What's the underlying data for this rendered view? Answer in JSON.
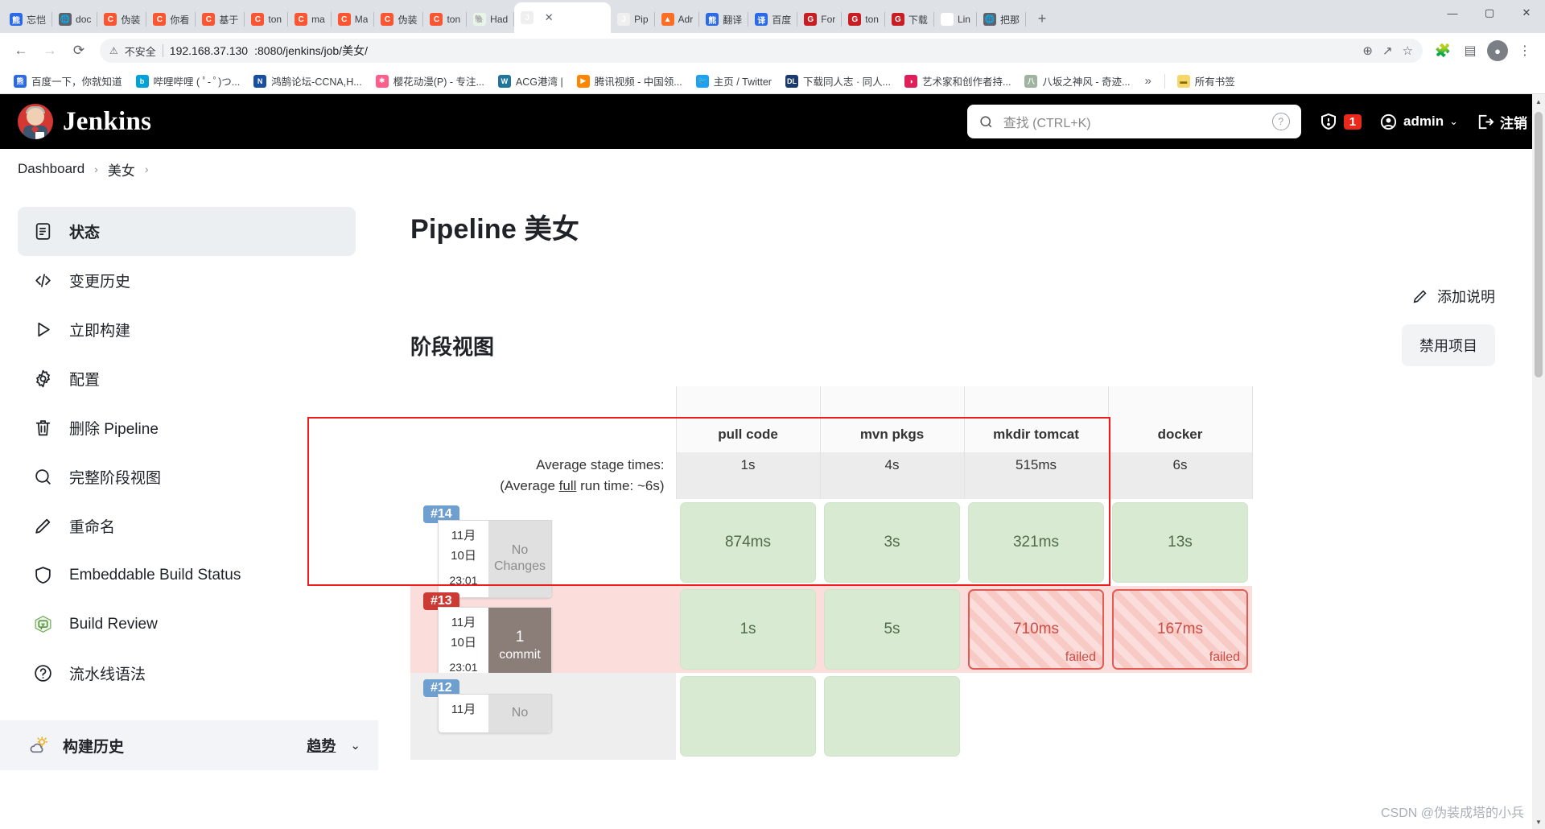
{
  "browser": {
    "tabs": [
      {
        "label": "忘恺",
        "icon": "baidu-favicon",
        "glyph": "熊",
        "cls": "fav-baidu",
        "active": false
      },
      {
        "label": "doc",
        "icon": "globe-favicon",
        "glyph": "🌐",
        "cls": "fav-globe",
        "active": false
      },
      {
        "label": "伪装",
        "icon": "csdn-favicon",
        "glyph": "C",
        "cls": "fav-csdn",
        "active": false
      },
      {
        "label": "你看",
        "icon": "csdn-favicon",
        "glyph": "C",
        "cls": "fav-csdn",
        "active": false
      },
      {
        "label": "基于",
        "icon": "csdn-favicon",
        "glyph": "C",
        "cls": "fav-csdn",
        "active": false
      },
      {
        "label": "ton",
        "icon": "csdn-favicon",
        "glyph": "C",
        "cls": "fav-csdn",
        "active": false
      },
      {
        "label": "ma",
        "icon": "csdn-favicon",
        "glyph": "C",
        "cls": "fav-csdn",
        "active": false
      },
      {
        "label": "Ma",
        "icon": "csdn-favicon",
        "glyph": "C",
        "cls": "fav-csdn",
        "active": false
      },
      {
        "label": "伪装",
        "icon": "csdn-favicon",
        "glyph": "C",
        "cls": "fav-csdn",
        "active": false
      },
      {
        "label": "ton",
        "icon": "csdn-favicon",
        "glyph": "C",
        "cls": "fav-csdn",
        "active": false
      },
      {
        "label": "Had",
        "icon": "hadoop-favicon",
        "glyph": "🐘",
        "cls": "fav-hadoop",
        "active": false
      },
      {
        "label": "",
        "icon": "jenkins-favicon",
        "glyph": "J",
        "cls": "fav-jenkins",
        "active": true
      },
      {
        "label": "Pip",
        "icon": "jenkins-favicon",
        "glyph": "J",
        "cls": "fav-jenkins",
        "active": false
      },
      {
        "label": "Adr",
        "icon": "gitlab-favicon",
        "glyph": "▲",
        "cls": "fav-gitlab",
        "active": false
      },
      {
        "label": "翻译",
        "icon": "baidu-favicon",
        "glyph": "熊",
        "cls": "fav-baidu",
        "active": false
      },
      {
        "label": "百度",
        "icon": "translate-favicon",
        "glyph": "译",
        "cls": "fav-trans",
        "active": false
      },
      {
        "label": "For",
        "icon": "gitee-favicon",
        "glyph": "G",
        "cls": "fav-gitee",
        "active": false
      },
      {
        "label": "ton",
        "icon": "gitee-favicon",
        "glyph": "G",
        "cls": "fav-gitee",
        "active": false
      },
      {
        "label": "下载",
        "icon": "gitee-favicon",
        "glyph": "G",
        "cls": "fav-gitee",
        "active": false
      },
      {
        "label": "Lin",
        "icon": "linux-favicon",
        "glyph": "∞",
        "cls": "fav-linux",
        "active": false
      },
      {
        "label": "把那",
        "icon": "globe-favicon",
        "glyph": "🌐",
        "cls": "fav-globe",
        "active": false
      }
    ],
    "new_tab_label": "+",
    "window_controls": {
      "minimize": "—",
      "maximize": "▢",
      "close": "✕"
    },
    "omnibox": {
      "security_label": "不安全",
      "url_host": "192.168.37.130",
      "url_rest": ":8080/jenkins/job/美女/"
    },
    "bookmarks": [
      {
        "label": "百度一下，你就知道",
        "glyph": "熊",
        "cls": "fav-baidu"
      },
      {
        "label": "哔哩哔哩 ( ﾟ- ﾟ)つ...",
        "glyph": "b",
        "cls": "bm-bili"
      },
      {
        "label": "鸿鹄论坛-CCNA,H...",
        "glyph": "N",
        "cls": "bm-hh"
      },
      {
        "label": "樱花动漫(P) - 专注...",
        "glyph": "✱",
        "cls": "bm-sakura"
      },
      {
        "label": "ACG港湾 |",
        "glyph": "W",
        "cls": "bm-acg"
      },
      {
        "label": "腾讯视频 - 中国领...",
        "glyph": "▶",
        "cls": "bm-tx"
      },
      {
        "label": "主页 / Twitter",
        "glyph": "🐦",
        "cls": "bm-tw"
      },
      {
        "label": "下载同人志 · 同人...",
        "glyph": "DL",
        "cls": "bm-dl"
      },
      {
        "label": "艺术家和创作者持...",
        "glyph": "◑",
        "cls": "bm-pixiv"
      },
      {
        "label": "八坂之神风 - 奇迹...",
        "glyph": "八",
        "cls": "bm-yasaka"
      }
    ],
    "bookmarks_overflow": "»",
    "all_bookmarks_label": "所有书签"
  },
  "jenkins": {
    "brand": "Jenkins",
    "search_placeholder": "查找 (CTRL+K)",
    "help_icon": "question-mark-icon",
    "notifications_count": "1",
    "user_name": "admin",
    "logout_label": "注销",
    "breadcrumbs": [
      "Dashboard",
      "美女"
    ],
    "breadcrumb_sep": "›"
  },
  "sidebar": {
    "items": [
      {
        "label": "状态",
        "icon": "status-icon",
        "active": true
      },
      {
        "label": "变更历史",
        "icon": "code-icon",
        "active": false
      },
      {
        "label": "立即构建",
        "icon": "play-icon",
        "active": false
      },
      {
        "label": "配置",
        "icon": "gear-icon",
        "active": false
      },
      {
        "label": "删除 Pipeline",
        "icon": "trash-icon",
        "active": false
      },
      {
        "label": "完整阶段视图",
        "icon": "search-icon",
        "active": false
      },
      {
        "label": "重命名",
        "icon": "pencil-icon",
        "active": false
      },
      {
        "label": "Embeddable Build Status",
        "icon": "shield-icon",
        "active": false
      },
      {
        "label": "Build Review",
        "icon": "review-icon",
        "active": false
      },
      {
        "label": "流水线语法",
        "icon": "help-icon",
        "active": false
      }
    ],
    "build_history": {
      "title": "构建历史",
      "icon": "weather-icon",
      "trend_label": "趋势",
      "caret": "⌄"
    }
  },
  "main": {
    "page_title": "Pipeline 美女",
    "add_description_label": "添加说明",
    "disable_project_label": "禁用项目",
    "stage_view_title": "阶段视图",
    "average_label_line1": "Average stage times:",
    "average_label_line2_pre": "(Average ",
    "average_label_line2_u": "full",
    "average_label_line2_post": " run time: ~6s)"
  },
  "chart_data": {
    "type": "table",
    "title": "阶段视图",
    "stages": [
      "pull code",
      "mvn pkgs",
      "mkdir tomcat",
      "docker"
    ],
    "average_stage_times": [
      "1s",
      "4s",
      "515ms",
      "6s"
    ],
    "average_full_run_time": "~6s",
    "meter_percents": [
      {
        "offset": 4,
        "width": 14
      },
      {
        "offset": 2,
        "width": 38
      },
      {
        "offset": 56,
        "width": 6
      },
      {
        "offset": 40,
        "width": 60
      }
    ],
    "rows": [
      {
        "build": "#14",
        "status": "ok",
        "month": "11月",
        "day": "10日",
        "time": "23:01",
        "changes_big": "No",
        "changes_small": "Changes",
        "changes_type": "nochg",
        "cells": [
          {
            "value": "874ms",
            "state": "success"
          },
          {
            "value": "3s",
            "state": "success"
          },
          {
            "value": "321ms",
            "state": "success"
          },
          {
            "value": "13s",
            "state": "success"
          }
        ]
      },
      {
        "build": "#13",
        "status": "fail",
        "month": "11月",
        "day": "10日",
        "time": "23:01",
        "changes_big": "1",
        "changes_small": "commit",
        "changes_type": "commit",
        "cells": [
          {
            "value": "1s",
            "state": "success"
          },
          {
            "value": "5s",
            "state": "success"
          },
          {
            "value": "710ms",
            "state": "failed",
            "fail_label": "failed"
          },
          {
            "value": "167ms",
            "state": "failed",
            "fail_label": "failed"
          }
        ]
      },
      {
        "build": "#12",
        "status": "ok",
        "month": "11月",
        "day": "",
        "time": "",
        "changes_big": "No",
        "changes_small": "",
        "changes_type": "nochg",
        "cells": [
          {
            "value": "",
            "state": "success"
          },
          {
            "value": "",
            "state": "success"
          },
          {
            "value": "",
            "state": "none"
          },
          {
            "value": "",
            "state": "none"
          }
        ]
      }
    ]
  },
  "watermark": "CSDN @伪装成塔的小兵"
}
